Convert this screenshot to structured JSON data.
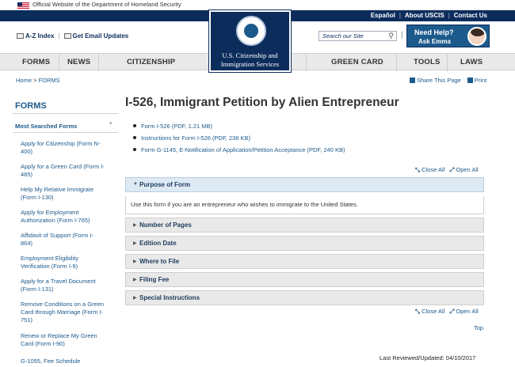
{
  "banner": {
    "text": "Official Website of the Department of Homeland Security"
  },
  "top_links": [
    "Español",
    "About USCIS",
    "Contact Us"
  ],
  "utility": {
    "az_index": "A-Z Index",
    "email_updates": "Get Email Updates"
  },
  "search": {
    "placeholder": "Search our Site"
  },
  "need_help": {
    "line1": "Need Help?",
    "line2": "Ask Emma"
  },
  "logo": {
    "line1": "U.S. Citizenship and",
    "line2": "Immigration Services"
  },
  "nav": {
    "forms": "FORMS",
    "news": "NEWS",
    "citizenship": "CITIZENSHIP",
    "green_card": "GREEN CARD",
    "tools": "TOOLS",
    "laws": "LAWS"
  },
  "breadcrumb": {
    "home": "Home",
    "separator": ">",
    "current": "FORMS"
  },
  "share": {
    "share_label": "Share This Page",
    "print_label": "Print"
  },
  "sidebar": {
    "title": "FORMS",
    "heading": "Most Searched Forms",
    "items": [
      {
        "label": "Apply for Citizenship (Form N-400)"
      },
      {
        "label": "Apply for a Green Card (Form I-485)"
      },
      {
        "label": "Help My Relative Immigrate (Form I-130)"
      },
      {
        "label": "Apply for Employment Authorization (Form I-765)"
      },
      {
        "label": "Affidavit of Support (Form I-864)"
      },
      {
        "label": "Employment Eligibility Verification (Form I-9)"
      },
      {
        "label": "Apply for a Travel Document (Form I-131)"
      },
      {
        "label": "Remove Conditions on a Green Card through Marriage (Form I-751)"
      },
      {
        "label": "Renew or Replace My Green Card (Form I-90)"
      },
      {
        "label": "G-1055, Fee Schedule"
      }
    ]
  },
  "main": {
    "title": "I-526, Immigrant Petition by Alien Entrepreneur",
    "downloads": [
      {
        "label": "Form I-526 (PDF, 1.21 MB)"
      },
      {
        "label": "Instructions for Form I-526 (PDF, 236 KB)"
      },
      {
        "label": "Form G-1145, E-Notification of Application/Petition Acceptance (PDF, 240 KB)"
      }
    ],
    "close_all": "Close All",
    "open_all": "Open All",
    "accordion": [
      {
        "label": "Purpose of Form",
        "expanded": true,
        "body": "Use this form if you are an entrepreneur who wishes to immigrate to the United States."
      },
      {
        "label": "Number of Pages"
      },
      {
        "label": "Edition Date"
      },
      {
        "label": "Where to File"
      },
      {
        "label": "Filing Fee"
      },
      {
        "label": "Special Instructions"
      }
    ],
    "top_link": "Top",
    "last_reviewed": "Last Reviewed/Updated: 04/10/2017"
  },
  "colors": {
    "navy": "#0c2d5c",
    "link": "#1d5a8c",
    "nav_bg": "#e9e9e9"
  }
}
